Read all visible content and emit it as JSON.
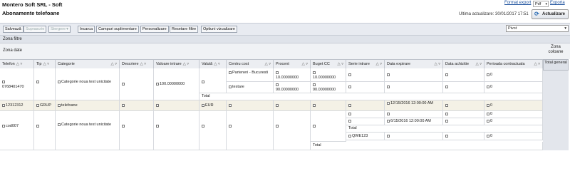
{
  "header": {
    "company": "Montero Soft SRL - Soft",
    "page_title": "Abonamente telefoane",
    "format_export_label": "Format export",
    "format_value": "Pdf",
    "export_label": "Exporta",
    "last_update": "Ultima actualizare: 30/01/2017 17:51",
    "update_button": "Actualizare"
  },
  "toolbar": {
    "buttons": [
      "Salvează",
      "Suprascrie",
      "Stergere",
      "Incarca",
      "Campuri suplimentare",
      "Personalizare",
      "Resetare filtre",
      "Optiuni vizualizare"
    ],
    "view_select": "Pivot"
  },
  "zones": {
    "filters": "Zona filtre",
    "data": "Zona date",
    "columns": "Zona coloane",
    "total_general": "Total general"
  },
  "columns": [
    "Telefon",
    "Tip",
    "Categorie",
    "Descriere",
    "Valoare intrare",
    "Valută",
    "Centru cost",
    "Procent",
    "Buget CC",
    "Serie intrare",
    "Data expirare",
    "Data achizitie",
    "Perioada contractuala"
  ],
  "rows": {
    "r1": {
      "telefon": "0768401470",
      "categorie": "Categorie noua test unicitate",
      "valoare": "100.00000000",
      "cc1": "Parteneri - Bucuresti",
      "cc2": "testare",
      "procent1": "10.00000000",
      "procent2": "90.00000000",
      "buget1": "10.00000000",
      "buget2": "90.00000000",
      "perioada1": "0",
      "perioada2": "0",
      "total": "Total"
    },
    "r2": {
      "telefon": "12312312",
      "tip": "GRUP",
      "categorie": "telefoane",
      "valuta": "EUR",
      "data_expirare": "12/15/2016 12:00:00 AM",
      "perioada": "0"
    },
    "r3": {
      "telefon": "cod007",
      "categorie": "Categorie noua test unicitate",
      "data_expirare": "6/15/2016 12:00:00 AM",
      "perioada1": "0",
      "perioada2": "0",
      "perioada3": "0",
      "perioada4": "0",
      "total_inner": "Total",
      "serie": "QWE123",
      "total": "Total"
    }
  }
}
